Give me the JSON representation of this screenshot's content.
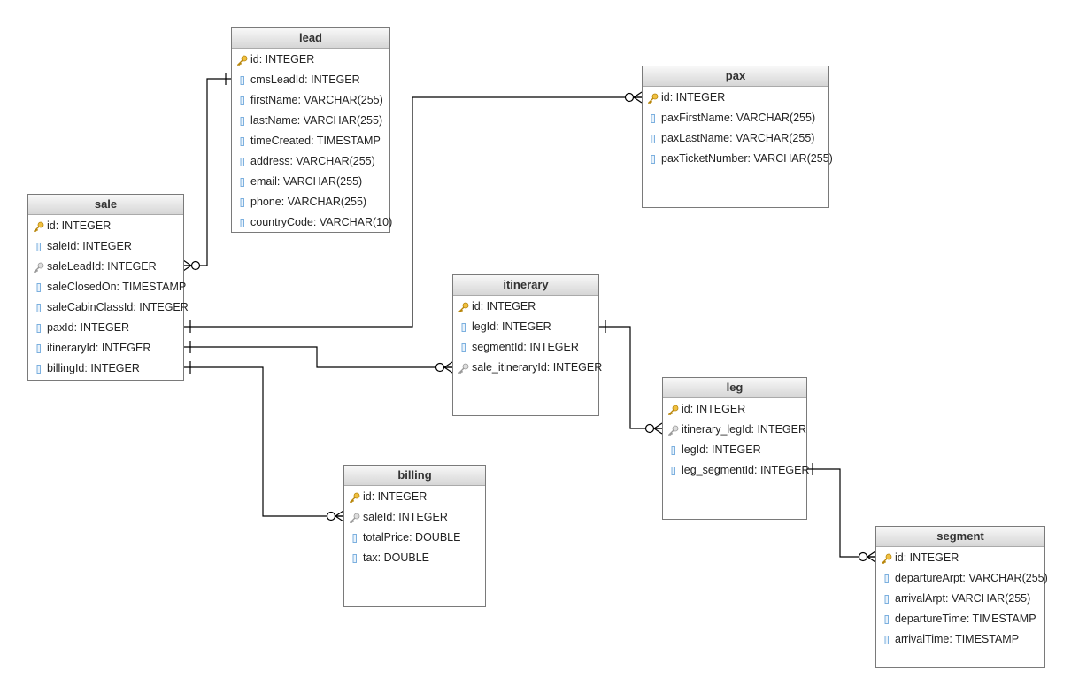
{
  "colors": {
    "pk": "#e8b02a",
    "fk": "#a0a0a0",
    "column": "#6fa8dc",
    "line": "#000000"
  },
  "tables": [
    {
      "id": "lead",
      "name": "lead",
      "columns": [
        {
          "label": "id: INTEGER",
          "icon": "primary-key-icon"
        },
        {
          "label": "cmsLeadId: INTEGER",
          "icon": "column-icon"
        },
        {
          "label": "firstName: VARCHAR(255)",
          "icon": "column-icon"
        },
        {
          "label": "lastName: VARCHAR(255)",
          "icon": "column-icon"
        },
        {
          "label": "timeCreated: TIMESTAMP",
          "icon": "column-icon"
        },
        {
          "label": "address: VARCHAR(255)",
          "icon": "column-icon"
        },
        {
          "label": "email: VARCHAR(255)",
          "icon": "column-icon"
        },
        {
          "label": "phone: VARCHAR(255)",
          "icon": "column-icon"
        },
        {
          "label": "countryCode: VARCHAR(10)",
          "icon": "column-icon"
        }
      ]
    },
    {
      "id": "pax",
      "name": "pax",
      "columns": [
        {
          "label": "id: INTEGER",
          "icon": "primary-key-icon"
        },
        {
          "label": "paxFirstName: VARCHAR(255)",
          "icon": "column-icon"
        },
        {
          "label": "paxLastName: VARCHAR(255)",
          "icon": "column-icon"
        },
        {
          "label": "paxTicketNumber: VARCHAR(255)",
          "icon": "column-icon"
        }
      ]
    },
    {
      "id": "sale",
      "name": "sale",
      "columns": [
        {
          "label": "id: INTEGER",
          "icon": "primary-key-icon"
        },
        {
          "label": "saleId: INTEGER",
          "icon": "column-icon"
        },
        {
          "label": "saleLeadId: INTEGER",
          "icon": "foreign-key-icon"
        },
        {
          "label": "saleClosedOn: TIMESTAMP",
          "icon": "column-icon"
        },
        {
          "label": "saleCabinClassId: INTEGER",
          "icon": "column-icon"
        },
        {
          "label": "paxId: INTEGER",
          "icon": "column-icon"
        },
        {
          "label": "itineraryId: INTEGER",
          "icon": "column-icon"
        },
        {
          "label": "billingId: INTEGER",
          "icon": "column-icon"
        }
      ]
    },
    {
      "id": "itinerary",
      "name": "itinerary",
      "columns": [
        {
          "label": "id: INTEGER",
          "icon": "primary-key-icon"
        },
        {
          "label": "legId: INTEGER",
          "icon": "column-icon"
        },
        {
          "label": "segmentId: INTEGER",
          "icon": "column-icon"
        },
        {
          "label": "sale_itineraryId: INTEGER",
          "icon": "foreign-key-icon"
        }
      ]
    },
    {
      "id": "leg",
      "name": "leg",
      "columns": [
        {
          "label": "id: INTEGER",
          "icon": "primary-key-icon"
        },
        {
          "label": "itinerary_legId: INTEGER",
          "icon": "foreign-key-icon"
        },
        {
          "label": "legId: INTEGER",
          "icon": "column-icon"
        },
        {
          "label": "leg_segmentId: INTEGER",
          "icon": "column-icon"
        }
      ]
    },
    {
      "id": "billing",
      "name": "billing",
      "columns": [
        {
          "label": "id: INTEGER",
          "icon": "primary-key-icon"
        },
        {
          "label": "saleId: INTEGER",
          "icon": "foreign-key-icon"
        },
        {
          "label": "totalPrice: DOUBLE",
          "icon": "column-icon"
        },
        {
          "label": "tax: DOUBLE",
          "icon": "column-icon"
        }
      ]
    },
    {
      "id": "segment",
      "name": "segment",
      "columns": [
        {
          "label": "id: INTEGER",
          "icon": "primary-key-icon"
        },
        {
          "label": "departureArpt: VARCHAR(255)",
          "icon": "column-icon"
        },
        {
          "label": "arrivalArpt: VARCHAR(255)",
          "icon": "column-icon"
        },
        {
          "label": "departureTime: TIMESTAMP",
          "icon": "column-icon"
        },
        {
          "label": "arrivalTime: TIMESTAMP",
          "icon": "column-icon"
        }
      ]
    }
  ],
  "relationships": [
    {
      "from": "sale.saleLeadId",
      "to": "lead.cmsLeadId",
      "from_end": "zero-or-many",
      "to_end": "one"
    },
    {
      "from": "sale.paxId",
      "to": "pax.id",
      "from_end": "one",
      "to_end": "zero-or-many"
    },
    {
      "from": "sale.itineraryId",
      "to": "itinerary.sale_itineraryId",
      "from_end": "one",
      "to_end": "zero-or-many"
    },
    {
      "from": "sale.billingId",
      "to": "billing.saleId",
      "from_end": "one",
      "to_end": "zero-or-many"
    },
    {
      "from": "itinerary.legId",
      "to": "leg.itinerary_legId",
      "from_end": "one",
      "to_end": "zero-or-many"
    },
    {
      "from": "leg.leg_segmentId",
      "to": "segment.id",
      "from_end": "one",
      "to_end": "zero-or-many"
    }
  ]
}
